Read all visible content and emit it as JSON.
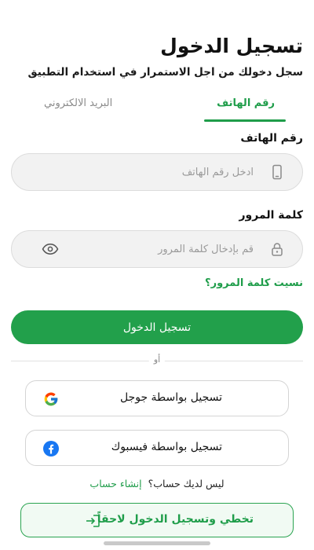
{
  "header": {
    "title": "تسجيل الدخول",
    "subtitle": "سجل دخولك من اجل الاستمرار في استخدام التطبيق"
  },
  "tabs": [
    {
      "label": "رقم الهاتف",
      "active": true
    },
    {
      "label": "البريد الالكتروني",
      "active": false
    }
  ],
  "phone_field": {
    "label": "رقم الهاتف",
    "placeholder": "ادخل رقم الهاتف",
    "value": "",
    "icon": "phone-icon"
  },
  "password_field": {
    "label": "كلمة المرور",
    "placeholder": "قم بإدخال كلمة المرور",
    "value": "",
    "icon": "lock-icon",
    "toggle_icon": "eye-icon"
  },
  "forgot_password": "نسيت كلمة المرور؟",
  "login_button": "تسجيل الدخول",
  "divider_text": "أو",
  "social": {
    "google_label": "تسجيل بواسطة جوجل",
    "facebook_label": "تسجيل بواسطة فيسبوك"
  },
  "signup": {
    "prompt": "ليس لديك حساب؟",
    "link": "إنشاء حساب"
  },
  "skip_button": "تخطي وتسجيل الدخول لاحقاً",
  "colors": {
    "accent": "#22a04b",
    "field_bg": "#f2f2f2",
    "facebook": "#1877f2"
  }
}
